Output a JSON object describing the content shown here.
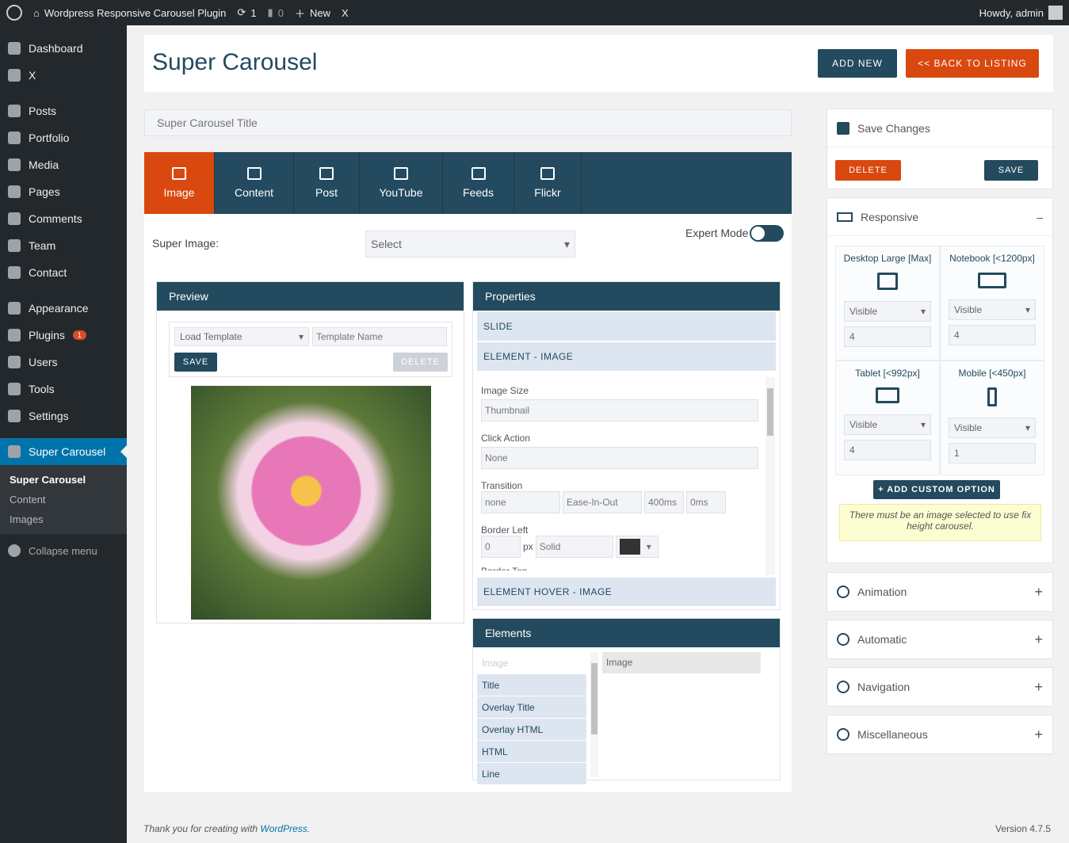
{
  "adminbar": {
    "site": "Wordpress Responsive Carousel Plugin",
    "updates": "1",
    "comments": "0",
    "new": "New",
    "x": "X",
    "howdy": "Howdy, admin"
  },
  "sidebar": {
    "items": [
      {
        "label": "Dashboard",
        "icon": "dashboard-icon"
      },
      {
        "label": "X",
        "icon": "chevron-right-icon"
      },
      {
        "label": "Posts",
        "icon": "pin-icon"
      },
      {
        "label": "Portfolio",
        "icon": "portfolio-icon"
      },
      {
        "label": "Media",
        "icon": "media-icon"
      },
      {
        "label": "Pages",
        "icon": "pages-icon"
      },
      {
        "label": "Comments",
        "icon": "comment-icon"
      },
      {
        "label": "Team",
        "icon": "pin-icon"
      },
      {
        "label": "Contact",
        "icon": "mail-icon"
      },
      {
        "label": "Appearance",
        "icon": "brush-icon"
      },
      {
        "label": "Plugins",
        "icon": "plugin-icon",
        "badge": "1"
      },
      {
        "label": "Users",
        "icon": "user-icon"
      },
      {
        "label": "Tools",
        "icon": "wrench-icon"
      },
      {
        "label": "Settings",
        "icon": "settings-icon"
      },
      {
        "label": "Super Carousel",
        "icon": "carousel-icon"
      }
    ],
    "sub": [
      "Super Carousel",
      "Content",
      "Images"
    ],
    "collapse": "Collapse menu"
  },
  "header": {
    "title": "Super Carousel",
    "add_new": "ADD NEW",
    "back": "<< BACK TO LISTING"
  },
  "title_placeholder": "Super Carousel Title",
  "tabs": [
    "Image",
    "Content",
    "Post",
    "YouTube",
    "Feeds",
    "Flickr"
  ],
  "super_image": {
    "label": "Super Image:",
    "value": "Select"
  },
  "expert_mode": {
    "label": "Expert Mode",
    "on": false
  },
  "preview": {
    "title": "Preview",
    "template": "Load Template",
    "template_name_placeholder": "Template Name",
    "save": "SAVE",
    "delete": "DELETE"
  },
  "properties": {
    "title": "Properties",
    "slide": "SLIDE",
    "element_image": "ELEMENT - IMAGE",
    "element_hover": "ELEMENT HOVER - IMAGE",
    "image_size_label": "Image Size",
    "image_size": "Thumbnail",
    "click_action_label": "Click Action",
    "click_action": "None",
    "transition_label": "Transition",
    "transition": [
      "none",
      "Ease-In-Out",
      "400ms",
      "0ms"
    ],
    "border_left_label": "Border Left",
    "border_left": "0",
    "px": "px",
    "border_style": "Solid",
    "border_color": "#333333",
    "border_top_label": "Border Top"
  },
  "elements": {
    "title": "Elements",
    "list": [
      "Image",
      "Title",
      "Overlay Title",
      "Overlay HTML",
      "HTML",
      "Line"
    ],
    "selected": "Image"
  },
  "right": {
    "save_changes": "Save Changes",
    "delete": "DELETE",
    "save": "SAVE",
    "responsive": "Responsive",
    "devices": [
      {
        "name": "Desktop Large [Max]",
        "vis": "Visible",
        "n": "4"
      },
      {
        "name": "Notebook [<1200px]",
        "vis": "Visible",
        "n": "4"
      },
      {
        "name": "Tablet [<992px]",
        "vis": "Visible",
        "n": "4"
      },
      {
        "name": "Mobile [<450px]",
        "vis": "Visible",
        "n": "1"
      }
    ],
    "add_custom": "+ ADD CUSTOM OPTION",
    "notice": "There must be an image selected to use fix height carousel.",
    "sections": [
      "Animation",
      "Automatic",
      "Navigation",
      "Miscellaneous"
    ]
  },
  "footer": {
    "thanks": "Thank you for creating with ",
    "wp": "WordPress",
    "dot": ".",
    "version": "Version 4.7.5"
  }
}
